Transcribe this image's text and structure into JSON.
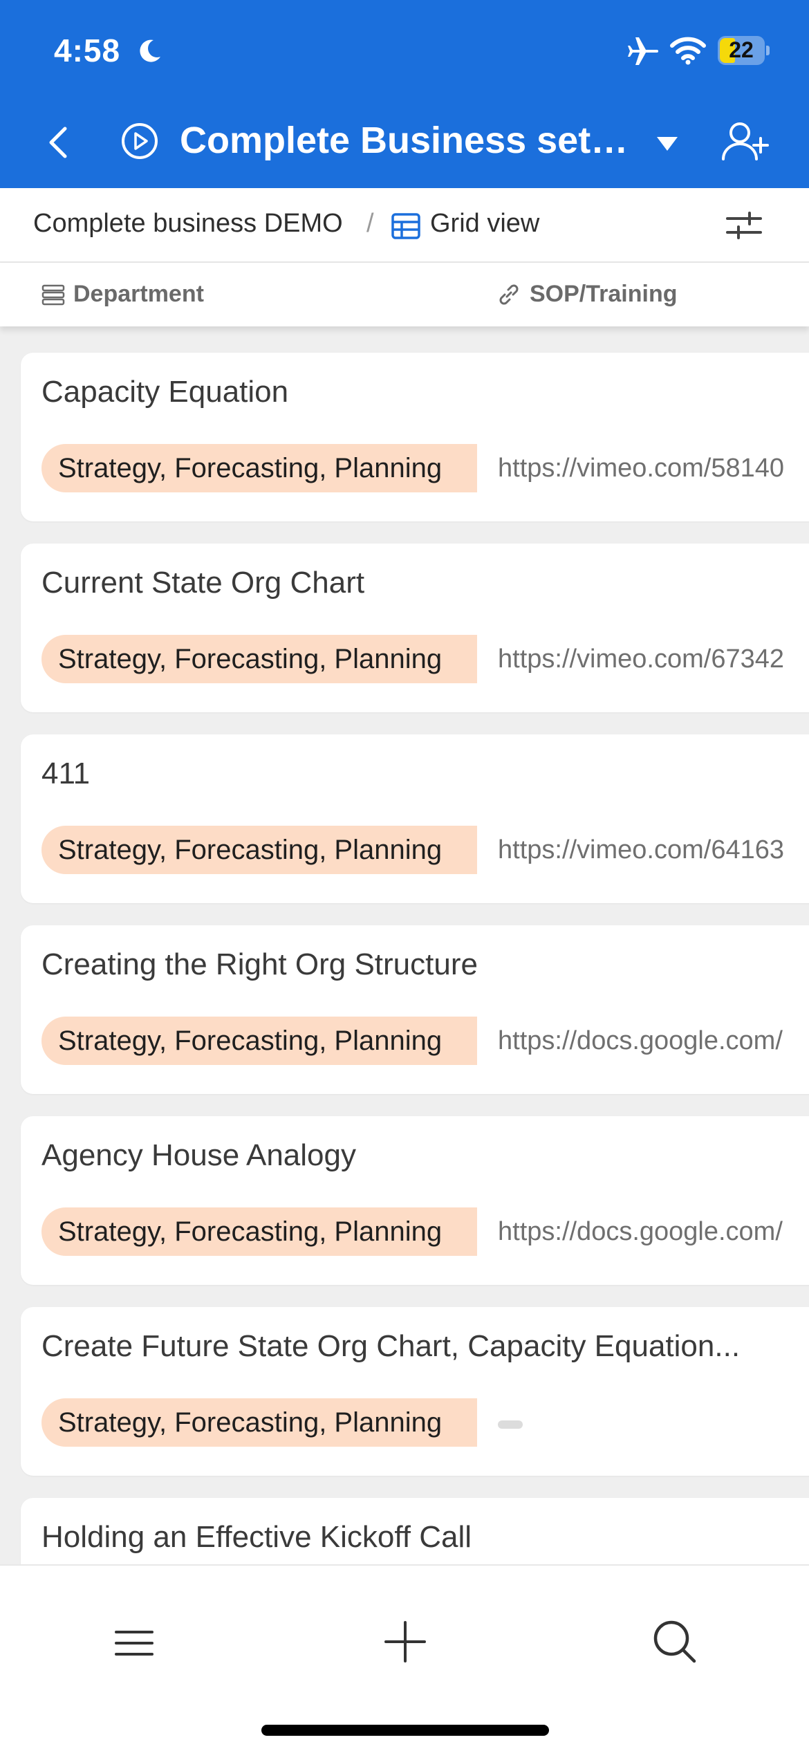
{
  "status_bar": {
    "time": "4:58",
    "battery": "22",
    "icons": [
      "moon-icon",
      "airplane-icon",
      "wifi-icon",
      "battery-icon"
    ],
    "battery_color": "#f5d90a"
  },
  "header": {
    "title": "Complete Business setu...",
    "icons": [
      "back-chevron-icon",
      "play-circle-icon",
      "caret-down-icon",
      "add-user-icon"
    ],
    "background": "#1b6fdc"
  },
  "breadcrumb": {
    "base": "Complete business DEMO",
    "separator": "/",
    "view": "Grid view",
    "icons": [
      "grid-table-icon",
      "sliders-icon"
    ]
  },
  "columns": {
    "department": "Department",
    "sop": "SOP/Training"
  },
  "records": [
    {
      "title": "Capacity Equation",
      "department": "Strategy, Forecasting, Planning",
      "link": "https://vimeo.com/58140"
    },
    {
      "title": "Current State Org Chart",
      "department": "Strategy, Forecasting, Planning",
      "link": "https://vimeo.com/67342"
    },
    {
      "title": "411",
      "department": "Strategy, Forecasting, Planning",
      "link": "https://vimeo.com/64163"
    },
    {
      "title": "Creating the Right Org Structure",
      "department": "Strategy, Forecasting, Planning",
      "link": "https://docs.google.com/"
    },
    {
      "title": "Agency House Analogy",
      "department": "Strategy, Forecasting, Planning",
      "link": "https://docs.google.com/"
    },
    {
      "title": "Create Future State Org Chart, Capacity Equation...",
      "department": "Strategy, Forecasting, Planning",
      "link": ""
    },
    {
      "title": "Holding an Effective Kickoff Call",
      "department": "",
      "link": ""
    }
  ],
  "tag_color": "#fddcc6",
  "bottom_bar": {
    "icons": [
      "menu-icon",
      "plus-icon",
      "search-icon"
    ]
  }
}
